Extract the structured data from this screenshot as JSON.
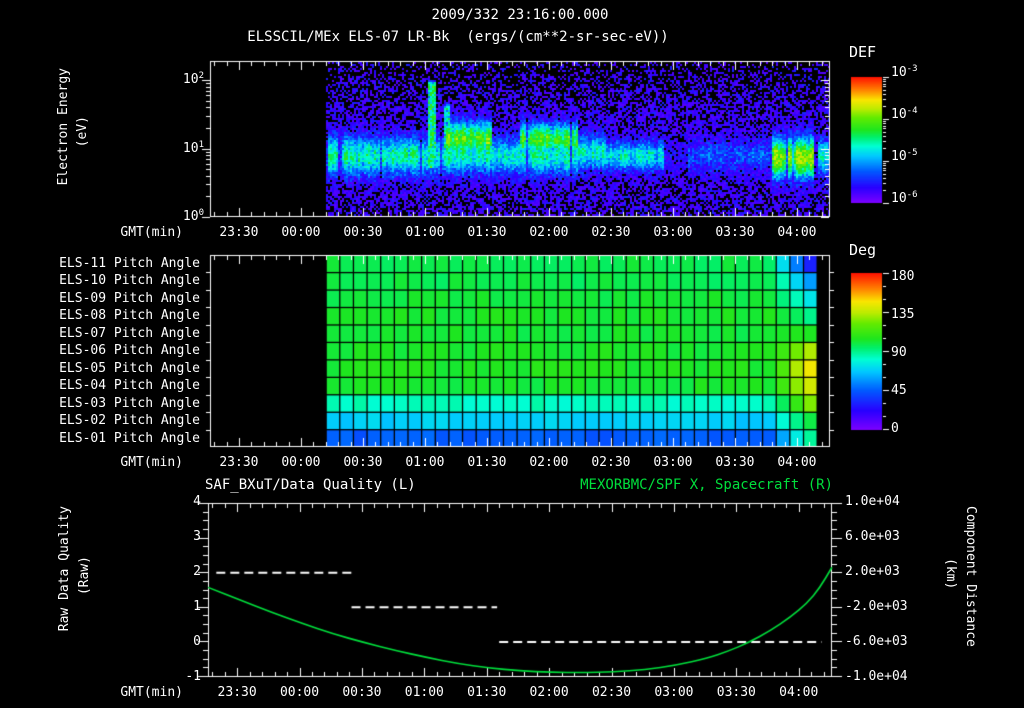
{
  "header": {
    "title": "2009/332 23:16:00.000",
    "subtitle": "ELSSCIL/MEx ELS-07 LR-Bk  (ergs/(cm**2-sr-sec-eV))"
  },
  "time_axis": {
    "label": "GMT(min)",
    "start_time": "23:16",
    "end_time": "04:16",
    "span_minutes": 300,
    "first_tick_minute": 14,
    "tick_interval_minutes": 30,
    "minor_tick_interval_minutes": 6,
    "ticks": [
      "23:30",
      "00:00",
      "00:30",
      "01:00",
      "01:30",
      "02:00",
      "02:30",
      "03:00",
      "03:30",
      "04:00"
    ]
  },
  "spectrogram": {
    "ylabel": "Electron Energy",
    "ylabel_units": "(eV)",
    "yticks": [
      {
        "base": "10",
        "exp": "2"
      },
      {
        "base": "10",
        "exp": "1"
      },
      {
        "base": "10",
        "exp": "0"
      }
    ],
    "colorbar": {
      "title": "DEF",
      "labels": [
        {
          "base": "10",
          "exp": "-3"
        },
        {
          "base": "10",
          "exp": "-4"
        },
        {
          "base": "10",
          "exp": "-5"
        },
        {
          "base": "10",
          "exp": "-6"
        }
      ]
    }
  },
  "pitch_panel": {
    "row_labels": [
      "ELS-11 Pitch Angle",
      "ELS-10 Pitch Angle",
      "ELS-09 Pitch Angle",
      "ELS-08 Pitch Angle",
      "ELS-07 Pitch Angle",
      "ELS-06 Pitch Angle",
      "ELS-05 Pitch Angle",
      "ELS-04 Pitch Angle",
      "ELS-03 Pitch Angle",
      "ELS-02 Pitch Angle",
      "ELS-01 Pitch Angle"
    ],
    "colorbar": {
      "title": "Deg",
      "labels": [
        "180",
        "135",
        "90",
        "45",
        "0"
      ]
    }
  },
  "bottom_panel": {
    "title_left": "SAF_BXuT/Data Quality (L)",
    "title_right": "MEXORBMC/SPF X, Spacecraft (R)",
    "ylabel_left_1": "Raw Data Quality",
    "ylabel_left_2": "(Raw)",
    "ylabel_right_1": "Component Distance",
    "ylabel_right_2": "(km)",
    "yticks_left": [
      "4",
      "3",
      "2",
      "1",
      "0",
      "-1"
    ],
    "yticks_right": [
      "1.0e+04",
      "6.0e+03",
      "2.0e+03",
      "-2.0e+03",
      "-6.0e+03",
      "-1.0e+04"
    ]
  },
  "colors": {
    "background": "#000000",
    "text": "#ffffff",
    "accent_green": "#00df3c"
  },
  "chart_data": [
    {
      "type": "heatmap",
      "name": "electron-energy-spectrogram",
      "title": "ELSSCIL/MEx ELS-07 LR-Bk electron differential energy flux",
      "xlabel": "GMT(min)",
      "ylabel": "Electron Energy (eV)",
      "x_range": [
        "23:16",
        "04:16"
      ],
      "y_range_ev": [
        1,
        180
      ],
      "y_scale": "log",
      "colorbar": {
        "title": "DEF",
        "units": "ergs/(cm**2-sr-sec-eV)",
        "range": [
          1e-06,
          0.001
        ],
        "scale": "log"
      },
      "data_start": "00:12",
      "features": [
        {
          "time": [
            "00:12",
            "01:01"
          ],
          "desc": "cyan band near 8 eV",
          "flux": 3e-05
        },
        {
          "time": [
            "01:01",
            "01:05"
          ],
          "desc": "narrow vertical spike up to ~80 eV",
          "flux": 6e-05
        },
        {
          "time": [
            "01:10",
            "01:32"
          ],
          "desc": "green blob 10-30 eV",
          "flux": 0.0001
        },
        {
          "time": [
            "01:46",
            "02:14"
          ],
          "desc": "green blob 10-25 eV",
          "flux": 9e-05
        },
        {
          "time": [
            "02:55",
            "03:07"
          ],
          "desc": "band gap",
          "flux": 3e-06
        },
        {
          "time": [
            "03:07",
            "03:47"
          ],
          "desc": "faint blue band",
          "flux": 8e-06
        },
        {
          "time": [
            "03:47",
            "04:08"
          ],
          "desc": "bright green patch 3-20 eV",
          "flux": 0.00012
        },
        {
          "time": [
            "04:10",
            "04:16"
          ],
          "desc": "small cyan patch",
          "flux": 3e-05
        }
      ],
      "render_note": "render_segments:[t0min,t1min,intensity0to1,centereV,widthpx]; render_blobs same; render_spikes:[t0,t1,topYpx,intensity]",
      "render_segments": [
        [
          56,
          104,
          0.45,
          8,
          15
        ],
        [
          104,
          113,
          0.42,
          8,
          15
        ],
        [
          113,
          136,
          0.45,
          8.5,
          15
        ],
        [
          136,
          150,
          0.43,
          8,
          14
        ],
        [
          150,
          178,
          0.45,
          8,
          14
        ],
        [
          178,
          191,
          0.44,
          9,
          13
        ],
        [
          191,
          219,
          0.4,
          8,
          11
        ],
        [
          219,
          231,
          0.1,
          8,
          11
        ],
        [
          231,
          271,
          0.22,
          8,
          13
        ],
        [
          271,
          292,
          0.46,
          8,
          16
        ],
        [
          292,
          294,
          0.1,
          8,
          12
        ],
        [
          294,
          300,
          0.42,
          8,
          13
        ]
      ],
      "render_blobs": [
        [
          114,
          136,
          14,
          13,
          0.62
        ],
        [
          150,
          178,
          14,
          12,
          0.58
        ],
        [
          271,
          292,
          7.5,
          15,
          0.66
        ]
      ],
      "render_spikes": [
        [
          105,
          109,
          84,
          0.48
        ],
        [
          113,
          116,
          107,
          0.42
        ]
      ]
    },
    {
      "type": "heatmap",
      "name": "pitch-angle-panel",
      "title": "ELS anode pitch angles",
      "xlabel": "GMT(min)",
      "units": "Deg",
      "value_range": [
        0,
        180
      ],
      "data_start": "00:12",
      "data_end": "04:10",
      "rows": [
        {
          "label": "ELS-11 Pitch Angle",
          "base_deg": 98,
          "end_deg": [
            72,
            52,
            30
          ]
        },
        {
          "label": "ELS-10 Pitch Angle",
          "base_deg": 98,
          "end_deg": [
            85,
            70,
            58
          ]
        },
        {
          "label": "ELS-09 Pitch Angle",
          "base_deg": 100,
          "end_deg": [
            92,
            84,
            74
          ]
        },
        {
          "label": "ELS-08 Pitch Angle",
          "base_deg": 103,
          "end_deg": [
            100,
            96,
            90
          ]
        },
        {
          "label": "ELS-07 Pitch Angle",
          "base_deg": 101,
          "end_deg": [
            103,
            105,
            104
          ]
        },
        {
          "label": "ELS-06 Pitch Angle",
          "base_deg": 103,
          "end_deg": [
            112,
            124,
            133
          ]
        },
        {
          "label": "ELS-05 Pitch Angle",
          "base_deg": 104,
          "end_deg": [
            116,
            133,
            146
          ]
        },
        {
          "label": "ELS-04 Pitch Angle",
          "base_deg": 102,
          "end_deg": [
            113,
            128,
            139
          ]
        },
        {
          "label": "ELS-03 Pitch Angle",
          "base_deg": 83,
          "end_deg": [
            96,
            110,
            126
          ]
        },
        {
          "label": "ELS-02 Pitch Angle",
          "base_deg": 68,
          "end_deg": [
            80,
            90,
            99
          ]
        },
        {
          "label": "ELS-01 Pitch Angle",
          "base_deg": 45,
          "end_deg": [
            60,
            76,
            88
          ]
        }
      ]
    },
    {
      "type": "line",
      "name": "quality-and-spacecraft-x",
      "ylim_left": [
        -1,
        4
      ],
      "ylim_right": [
        -10000,
        10000
      ],
      "series": [
        {
          "name": "SAF_BXuT/Data Quality (L)",
          "axis": "left",
          "style": "dashed-white",
          "segments": [
            {
              "t": [
                "23:20",
                "00:25"
              ],
              "value": 2
            },
            {
              "t": [
                "00:25",
                "01:35"
              ],
              "value": 1
            },
            {
              "t": [
                "01:36",
                "04:11"
              ],
              "value": 0
            }
          ]
        },
        {
          "name": "MEXORBMC/SPF X, Spacecraft (R)",
          "axis": "right",
          "style": "solid-green",
          "units": "km",
          "points_t_min": [
            0,
            15,
            30,
            45,
            60,
            75,
            90,
            105,
            120,
            135,
            150,
            165,
            180,
            195,
            210,
            225,
            240,
            250,
            260,
            270,
            280,
            288,
            294,
            300
          ],
          "points_km": [
            300,
            -1100,
            -2500,
            -3800,
            -5000,
            -6000,
            -6900,
            -7700,
            -8400,
            -8900,
            -9250,
            -9400,
            -9450,
            -9350,
            -9100,
            -8600,
            -7800,
            -7000,
            -6000,
            -4700,
            -3100,
            -1500,
            200,
            2600
          ]
        }
      ]
    }
  ]
}
